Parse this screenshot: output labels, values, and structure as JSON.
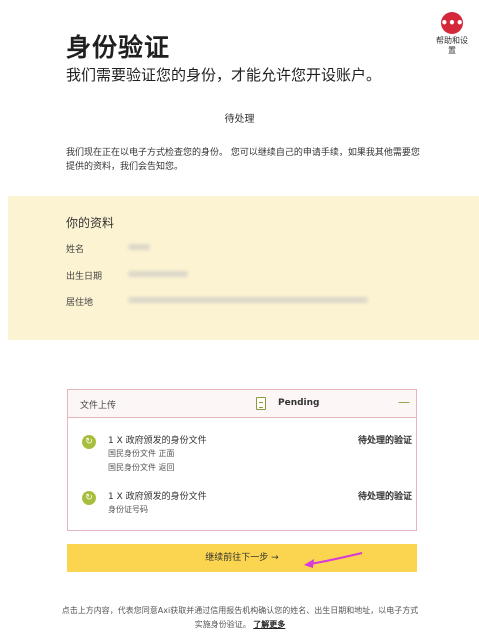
{
  "help": {
    "label": "帮助和设置",
    "icon": "more-dots-icon",
    "color": "#d4283a"
  },
  "header": {
    "title": "身份验证",
    "subtitle": "我们需要验证您的身份，才能允许您开设账户。"
  },
  "status_label": "待处理",
  "description": "我们现在正在以电子方式检查您的身份。 您可以继续自己的申请手续，如果我其他需要您提供的资料，我们会告知您。",
  "info": {
    "heading": "你的资料",
    "rows": [
      {
        "label": "姓名"
      },
      {
        "label": "出生日期"
      },
      {
        "label": "居住地"
      }
    ],
    "background": "#fcf3d2"
  },
  "upload": {
    "title": "文件上传",
    "status": "Pending",
    "collapse_icon": "minus-icon",
    "documents": [
      {
        "title": "1 X 政府颁发的身份文件",
        "status": "待处理的验证",
        "sub": [
          "国民身份文件 正面",
          "国民身份文件 返回"
        ]
      },
      {
        "title": "1 X 政府颁发的身份文件",
        "status": "待处理的验证",
        "sub": [
          "身份证号码"
        ]
      }
    ]
  },
  "continue_button": {
    "label": "继续前往下一步 →",
    "color": "#fbd54f"
  },
  "footer": {
    "text": "点击上方内容，代表您同意Axi获取并通过信用报告机构确认您的姓名、出生日期和地址，以电子方式实施身份验证。",
    "link": "了解更多"
  },
  "colors": {
    "accent": "#d4283a",
    "check": "#a8bf3e",
    "annotation_arrow": "#d63ad8"
  }
}
